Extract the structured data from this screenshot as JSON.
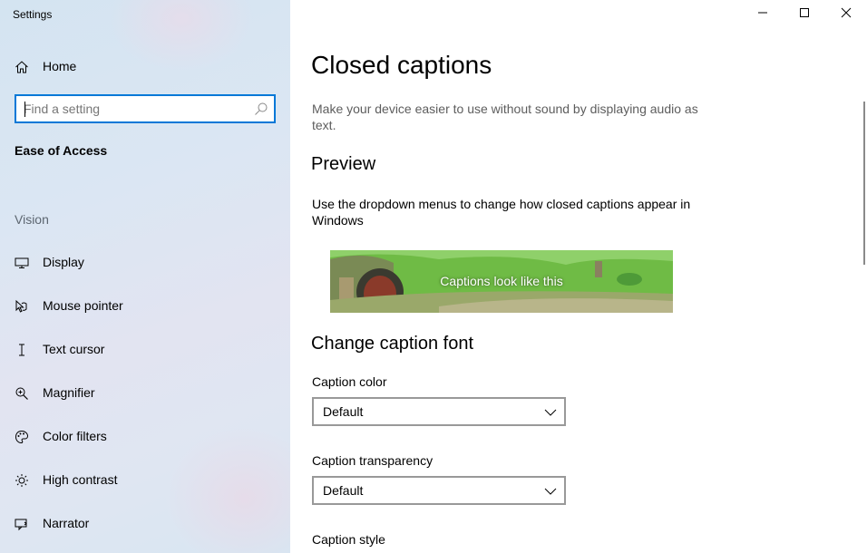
{
  "window": {
    "title": "Settings"
  },
  "sidebar": {
    "home_label": "Home",
    "search_placeholder": "Find a setting",
    "section_title": "Ease of Access",
    "group_label": "Vision",
    "items": [
      {
        "label": "Display",
        "icon": "monitor-icon"
      },
      {
        "label": "Mouse pointer",
        "icon": "mouse-pointer-icon"
      },
      {
        "label": "Text cursor",
        "icon": "text-cursor-icon"
      },
      {
        "label": "Magnifier",
        "icon": "magnifier-icon"
      },
      {
        "label": "Color filters",
        "icon": "color-palette-icon"
      },
      {
        "label": "High contrast",
        "icon": "sun-icon"
      },
      {
        "label": "Narrator",
        "icon": "narrator-icon"
      }
    ]
  },
  "main": {
    "title": "Closed captions",
    "description": "Make your device easier to use without sound by displaying audio as text.",
    "preview_heading": "Preview",
    "preview_text": "Use the dropdown menus to change how closed captions appear in Windows",
    "preview_caption": "Captions look like this",
    "font_heading": "Change caption font",
    "caption_color_label": "Caption color",
    "caption_color_value": "Default",
    "caption_transparency_label": "Caption transparency",
    "caption_transparency_value": "Default",
    "caption_style_label": "Caption style"
  },
  "colors": {
    "accent": "#0078d7"
  }
}
